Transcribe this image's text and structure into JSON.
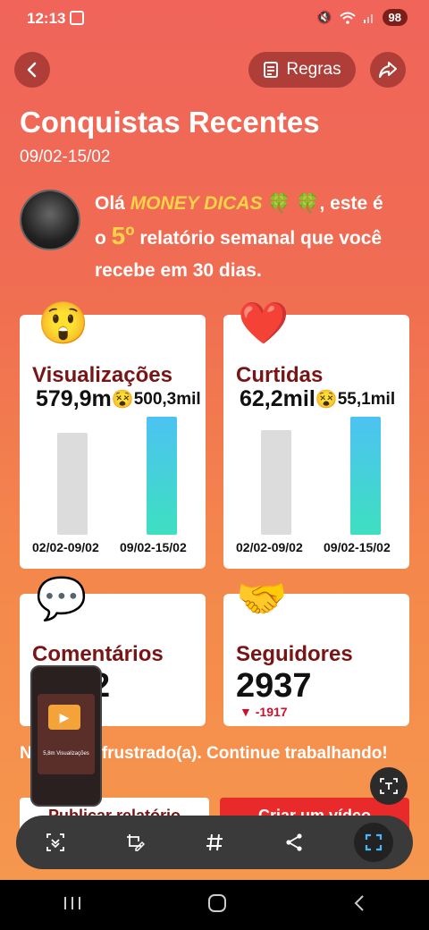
{
  "status": {
    "time": "12:13",
    "battery": "98"
  },
  "header": {
    "rules_label": "Regras"
  },
  "title": "Conquistas Recentes",
  "date_range": "09/02-15/02",
  "greeting": {
    "prefix": "Olá ",
    "name": "MONEY DICAS",
    "clover": "🍀 🍀",
    "mid": ", este é o ",
    "number": "5º",
    "suffix": " relatório semanal que você recebe em 30 dias."
  },
  "cards": {
    "views": {
      "emoji": "😲",
      "title": "Visualizações",
      "current": "579,9m",
      "emoji_mid": "😵",
      "previous": "500,3mil",
      "prev_label": "02/02-09/02",
      "cur_label": "09/02-15/02",
      "prev_ratio": 0.86,
      "cur_ratio": 1.0
    },
    "likes": {
      "emoji": "❤️",
      "title": "Curtidas",
      "current": "62,2mil",
      "emoji_mid": "😵",
      "previous": "55,1mil",
      "prev_label": "02/02-09/02",
      "cur_label": "09/02-15/02",
      "prev_ratio": 0.89,
      "cur_ratio": 1.0
    },
    "comments": {
      "emoji": "💬",
      "title": "Comentários",
      "value": "2"
    },
    "followers": {
      "emoji": "🤝",
      "title": "Seguidores",
      "value": "2937",
      "change": "▼ -1917"
    }
  },
  "motivation": "Não fique frustrado(a). Continue trabalhando!",
  "buttons": {
    "publish": "Publicar relatório",
    "create": "Criar um vídeo"
  },
  "mini_preview": {
    "caption": "5,8m Visualizações"
  },
  "colors": {
    "accent": "#7a1414",
    "bar_current": "#3ec9e0",
    "bar_previous": "#dcdcdc",
    "decrease": "#d0102a"
  }
}
